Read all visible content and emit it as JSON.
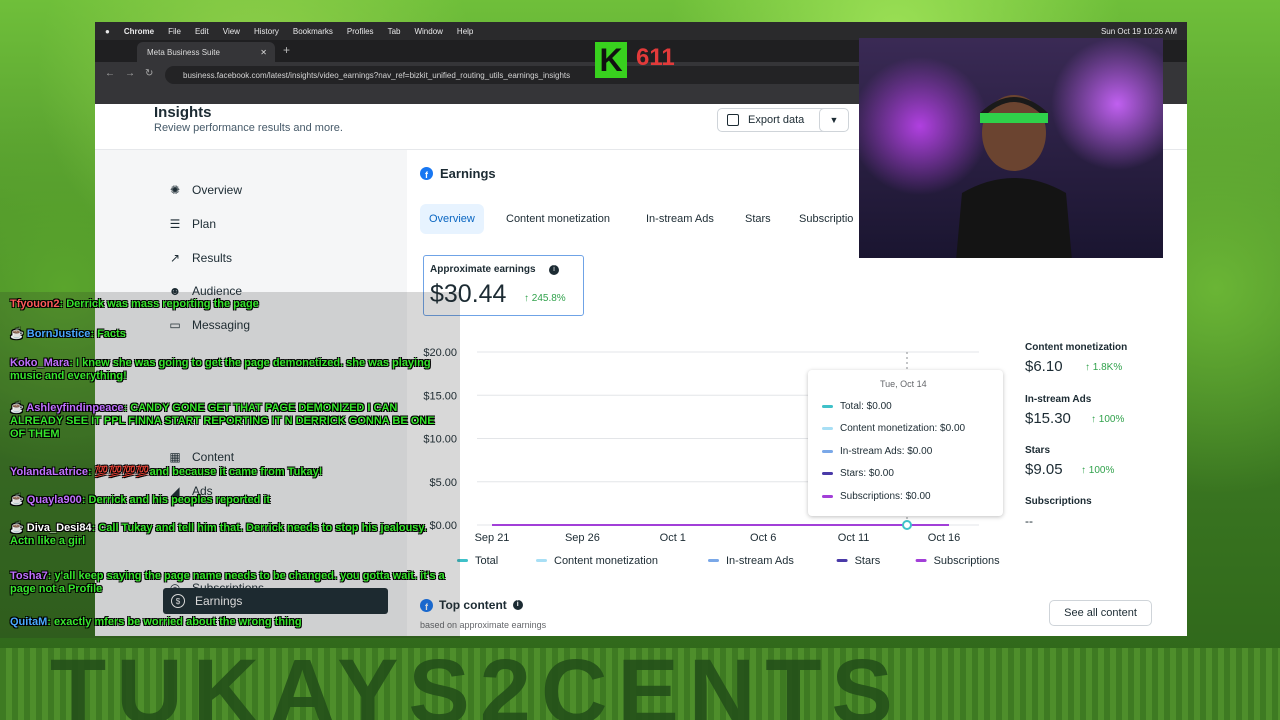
{
  "menubar": {
    "app": "Chrome",
    "items": [
      "File",
      "Edit",
      "View",
      "History",
      "Bookmarks",
      "Profiles",
      "Tab",
      "Window",
      "Help"
    ],
    "clock": "Sun Oct 19 10:26 AM"
  },
  "browser": {
    "tab_title": "Meta Business Suite",
    "url": "business.facebook.com/latest/insights/video_earnings?nav_ref=bizkit_unified_routing_utils_earnings_insights"
  },
  "header": {
    "title": "Insights",
    "subtitle": "Review performance results and more.",
    "export_label": "Export data"
  },
  "sidebar": {
    "items": [
      {
        "label": "Overview",
        "icon": "overview-icon"
      },
      {
        "label": "Plan",
        "icon": "list-icon"
      },
      {
        "label": "Results",
        "icon": "trend-icon"
      },
      {
        "label": "Audience",
        "icon": "people-icon"
      },
      {
        "label": "Messaging",
        "icon": "message-icon"
      },
      {
        "label": "Content",
        "icon": "grid-icon"
      },
      {
        "label": "Ads",
        "icon": "megaphone-icon"
      },
      {
        "label": "Earnings",
        "icon": "dollar-icon"
      },
      {
        "label": "Subscriptions",
        "icon": "subscriptions-icon"
      }
    ]
  },
  "earnings": {
    "title": "Earnings",
    "tabs": [
      "Overview",
      "Content monetization",
      "In-stream Ads",
      "Stars",
      "Subscriptio"
    ],
    "kpi": {
      "label": "Approximate earnings",
      "value": "$30.44",
      "change": "↑ 245.8%"
    }
  },
  "side_stats": [
    {
      "label": "Content monetization",
      "value": "$6.10",
      "change": "↑ 1.8K%"
    },
    {
      "label": "In-stream Ads",
      "value": "$15.30",
      "change": "↑ 100%"
    },
    {
      "label": "Stars",
      "value": "$9.05",
      "change": "↑ 100%"
    },
    {
      "label": "Subscriptions",
      "value": "--",
      "change": ""
    }
  ],
  "tooltip": {
    "date": "Tue, Oct 14",
    "rows": [
      {
        "label": "Total: $0.00",
        "color": "#3fc1c9"
      },
      {
        "label": "Content monetization: $0.00",
        "color": "#a8dff5"
      },
      {
        "label": "In-stream Ads: $0.00",
        "color": "#7aa8e8"
      },
      {
        "label": "Stars: $0.00",
        "color": "#4a3aa8"
      },
      {
        "label": "Subscriptions: $0.00",
        "color": "#a23fd8"
      }
    ]
  },
  "chart_data": {
    "type": "line",
    "yticks": [
      "$20.00",
      "$15.00",
      "$10.00",
      "$5.00",
      "$0.00"
    ],
    "ylim": [
      0,
      20
    ],
    "xticks": [
      "Sep 21",
      "Sep 26",
      "Oct 1",
      "Oct 6",
      "Oct 11",
      "Oct 16"
    ],
    "series": [
      {
        "name": "Total",
        "color": "#3fc1c9"
      },
      {
        "name": "Content monetization",
        "color": "#a8dff5"
      },
      {
        "name": "In-stream Ads",
        "color": "#7aa8e8"
      },
      {
        "name": "Stars",
        "color": "#4a3aa8"
      },
      {
        "name": "Subscriptions",
        "color": "#a23fd8"
      }
    ]
  },
  "top_content": {
    "title": "Top content",
    "subtitle": "based on approximate earnings",
    "button": "See all content"
  },
  "chat": [
    {
      "user": "Tfyouon2",
      "color": "#ff5a5a",
      "text": "Derrick was mass reporting the page"
    },
    {
      "user": "BornJustice",
      "color": "#4aa8ff",
      "text": "Facts"
    },
    {
      "user": "Koko_Mara",
      "color": "#c070ff",
      "text": "I knew she was going to get the page demonetized. she was playing music and everything!"
    },
    {
      "user": "Ashleyfindinpeace",
      "color": "#c070ff",
      "text": "CANDY GONE GET THAT PAGE DEMONIZED I CAN ALREADY SEE IT PPL FINNA START REPORTING IT N DERRICK GONNA BE ONE OF THEM"
    },
    {
      "user": "YolandaLatrice",
      "color": "#c070ff",
      "text": "💯💯💯💯and because it came from Tukay!"
    },
    {
      "user": "Quayla900",
      "color": "#c070ff",
      "text": "Derrick and his peoples reported it"
    },
    {
      "user": "Diva_Desi84",
      "color": "#ffffff",
      "text": "Call Tukay and tell him that. Derrick needs to stop his jealousy. Actn like a girl"
    },
    {
      "user": "Tosha7",
      "color": "#c070ff",
      "text": "y'all keep saying the page name needs to be changed. you gotta wait. it's a page not a Profile"
    },
    {
      "user": "QuitaM",
      "color": "#4aa8ff",
      "text": "exactly mfers be worried about the wrong thing"
    }
  ],
  "stream": {
    "logo_letter": "K",
    "logo_number": "611",
    "banner_text": "TUKAYS2CENTS"
  }
}
